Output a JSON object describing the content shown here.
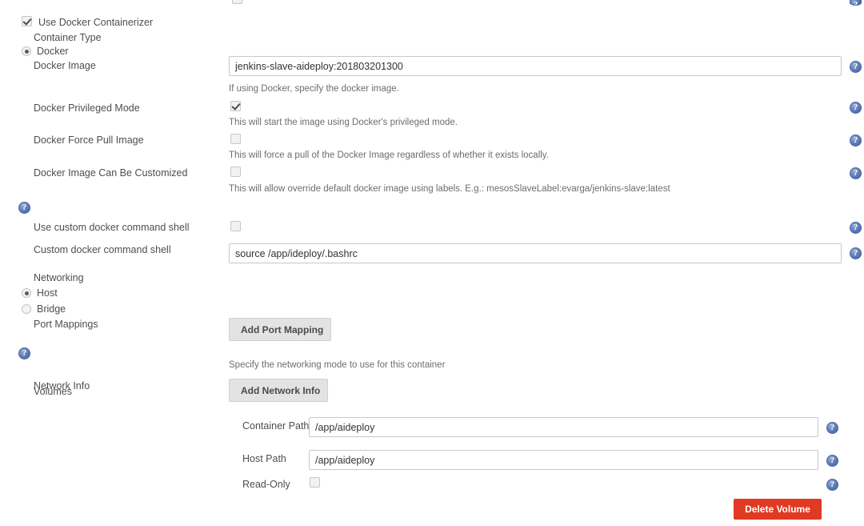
{
  "colors": {
    "accent_blue": "#4a68a6",
    "danger_red": "#e03a22",
    "button_gray": "#e3e3e3",
    "label_text": "#4e4e4e",
    "help_text": "#6d6d6d"
  },
  "form": {
    "use_docker_containerizer": {
      "label": "Use Docker Containerizer",
      "checked": true
    },
    "container_type": {
      "label": "Container Type",
      "options": [
        {
          "label": "Docker",
          "selected": true
        }
      ]
    },
    "docker_image": {
      "label": "Docker Image",
      "value": "jenkins-slave-aideploy:201803201300",
      "placeholder": "",
      "help": "If using Docker, specify the docker image."
    },
    "docker_privileged_mode": {
      "label": "Docker Privileged Mode",
      "checked": true,
      "help": "This will start the image using Docker's privileged mode."
    },
    "docker_force_pull_image": {
      "label": "Docker Force Pull Image",
      "checked": false,
      "help": "This will force a pull of the Docker Image regardless of whether it exists locally."
    },
    "docker_image_can_be_customized": {
      "label": "Docker Image Can Be Customized",
      "checked": false,
      "help": "This will allow override default docker image using labels. E.g.: mesosSlaveLabel:evarga/jenkins-slave:latest"
    },
    "use_custom_docker_command_shell": {
      "label": "Use custom docker command shell",
      "checked": false
    },
    "custom_docker_command_shell": {
      "label": "Custom docker command shell",
      "value": "source /app/ideploy/.bashrc",
      "placeholder": ""
    },
    "networking": {
      "label": "Networking",
      "options": [
        {
          "label": "Host",
          "selected": true
        },
        {
          "label": "Bridge",
          "selected": false
        }
      ],
      "help": "Specify the networking mode to use for this container"
    },
    "port_mappings": {
      "label": "Port Mappings",
      "add_button": "Add Port Mapping"
    },
    "network_info": {
      "label": "Network Info",
      "add_button": "Add Network Info"
    },
    "volumes": {
      "label": "Volumes",
      "entries": [
        {
          "container_path": {
            "label": "Container Path",
            "value": "/app/aideploy",
            "placeholder": ""
          },
          "host_path": {
            "label": "Host Path",
            "value": "/app/aideploy",
            "placeholder": ""
          },
          "read_only": {
            "label": "Read-Only",
            "checked": false
          },
          "delete_button": "Delete Volume"
        }
      ]
    }
  },
  "icons": {
    "help": "help-question-icon"
  }
}
